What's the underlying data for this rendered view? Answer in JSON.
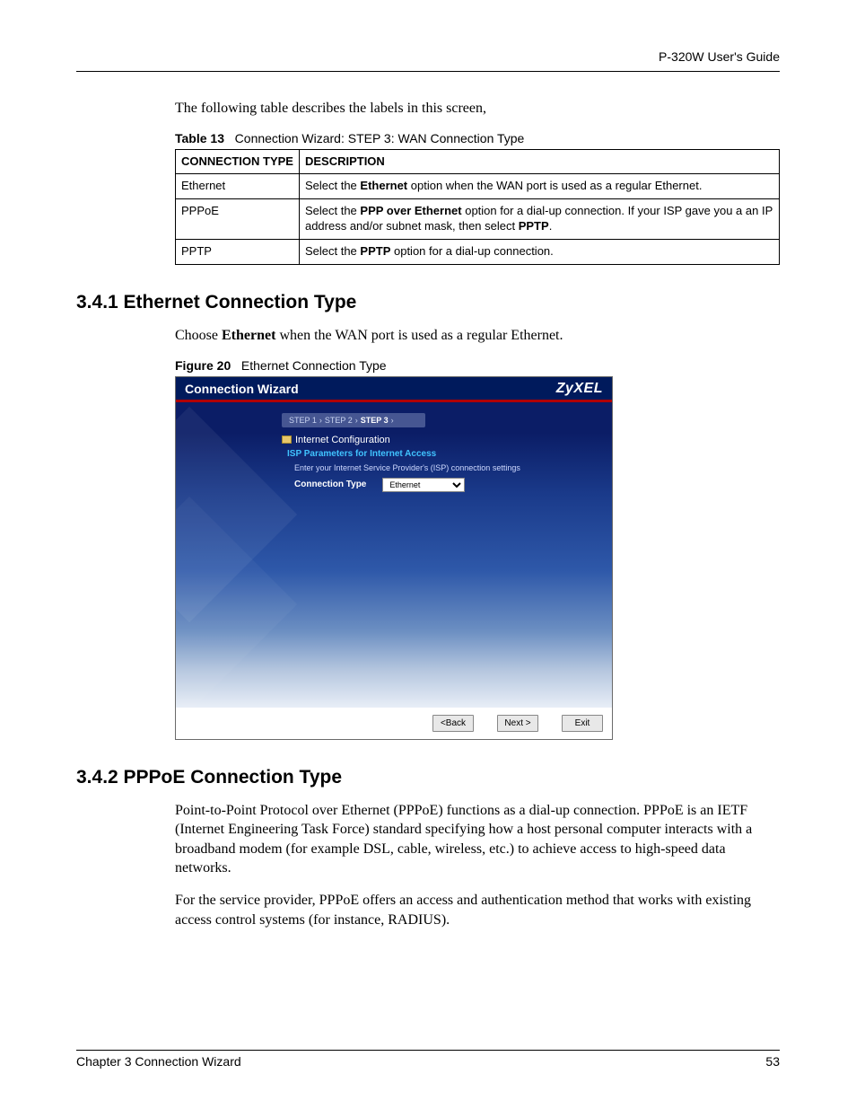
{
  "header": {
    "guide": "P-320W User's Guide"
  },
  "intro_text": "The following table describes the labels in this screen,",
  "table_caption": {
    "label": "Table 13",
    "title": "Connection Wizard: STEP 3: WAN Connection Type"
  },
  "table": {
    "headers": [
      "CONNECTION TYPE",
      "DESCRIPTION"
    ],
    "rows": [
      {
        "type": "Ethernet",
        "desc_pre": "Select the ",
        "desc_b1": "Ethernet",
        "desc_post": " option when the WAN port is used as a regular Ethernet."
      },
      {
        "type": "PPPoE",
        "desc_pre": "Select the ",
        "desc_b1": "PPP over Ethernet",
        "desc_mid": " option for a dial-up connection. If your ISP gave you a an IP address and/or subnet mask, then select ",
        "desc_b2": "PPTP",
        "desc_post": "."
      },
      {
        "type": "PPTP",
        "desc_pre": "Select the ",
        "desc_b1": "PPTP",
        "desc_post": " option for a dial-up connection."
      }
    ]
  },
  "section_341": {
    "heading": "3.4.1  Ethernet Connection Type",
    "body_pre": "Choose ",
    "body_b": "Ethernet",
    "body_post": " when the WAN port is used as a regular Ethernet.",
    "fig_label": "Figure 20",
    "fig_title": "Ethernet Connection Type"
  },
  "wizard": {
    "title": "Connection Wizard",
    "brand": "ZyXEL",
    "steps": {
      "s1": "STEP 1",
      "s2": "STEP 2",
      "s3": "STEP 3",
      "sep": "›"
    },
    "folder_line": "Internet Configuration",
    "subhead": "ISP Parameters for Internet Access",
    "hint": "Enter your Internet Service Provider's (ISP) connection settings",
    "conn_label": "Connection Type",
    "conn_value": "Ethernet",
    "buttons": {
      "back": "<Back",
      "next": "Next >",
      "exit": "Exit"
    }
  },
  "section_342": {
    "heading": "3.4.2  PPPoE Connection Type",
    "p1": "Point-to-Point Protocol over Ethernet (PPPoE) functions as a dial-up connection. PPPoE is an IETF (Internet Engineering Task Force) standard specifying how a host personal computer interacts with a broadband modem (for example DSL, cable, wireless, etc.) to achieve access to high-speed data networks.",
    "p2": "For the service provider, PPPoE offers an access and authentication method that works with existing access control systems (for instance, RADIUS)."
  },
  "footer": {
    "chapter": "Chapter 3 Connection Wizard",
    "page": "53"
  }
}
